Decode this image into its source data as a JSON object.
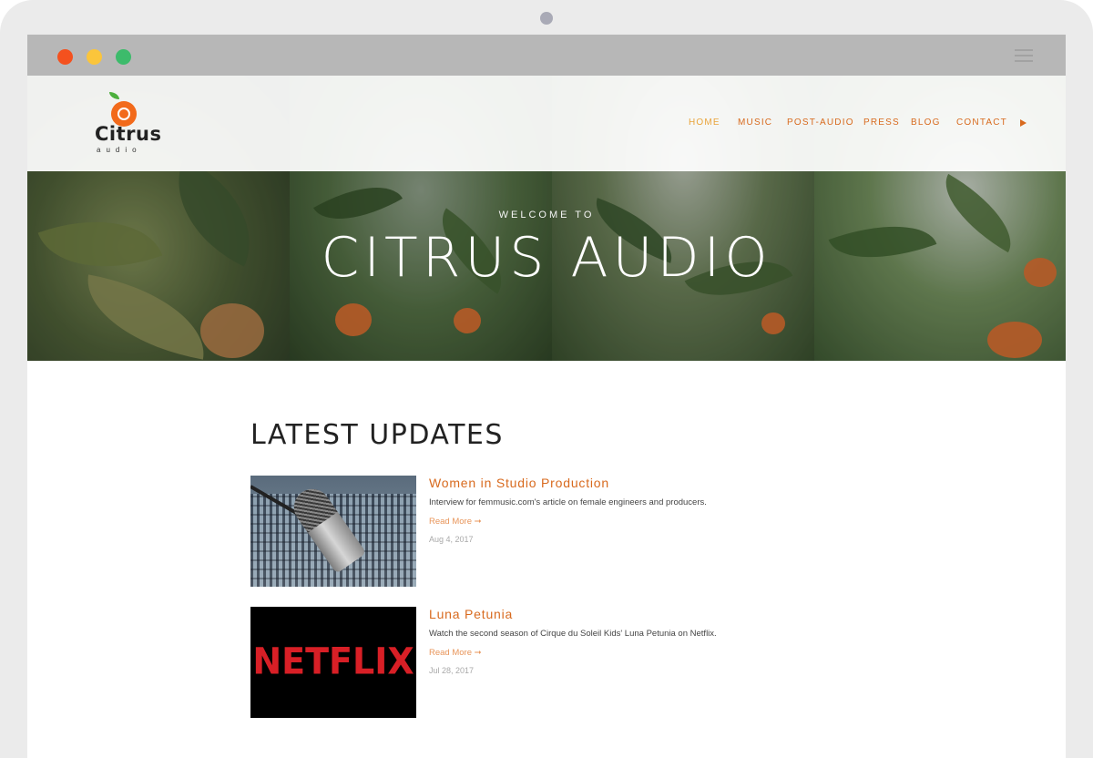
{
  "site": {
    "logo": {
      "word": "Citrus",
      "sub": "audio"
    },
    "nav": [
      {
        "label": "HOME",
        "active": true
      },
      {
        "label": "MUSIC",
        "active": false
      },
      {
        "label": "POST-AUDIO",
        "active": false
      },
      {
        "label": "PRESS",
        "active": false
      },
      {
        "label": "BLOG",
        "active": false
      },
      {
        "label": "CONTACT",
        "active": false
      }
    ],
    "nav_extra_icon": "play-icon"
  },
  "hero": {
    "kicker": "WELCOME TO",
    "title": "CITRUS AUDIO"
  },
  "updates": {
    "heading": "LATEST UPDATES",
    "posts": [
      {
        "title": "Women in Studio Production",
        "excerpt": "Interview for femmusic.com's article on female engineers and producers.",
        "read_more": "Read More ➞",
        "date": "Aug 4, 2017",
        "thumb": "microphone-mixer-image"
      },
      {
        "title": "Luna Petunia",
        "excerpt": "Watch the second season of Cirque du Soleil Kids' Luna Petunia on Netflix.",
        "read_more": "Read More ➞",
        "date": "Jul 28, 2017",
        "thumb": "netflix-logo-image",
        "thumb_text": "NETFLIX"
      }
    ]
  },
  "colors": {
    "accent": "#d86a1e",
    "active_nav": "#e9a43b",
    "netflix_red": "#d81f26"
  }
}
